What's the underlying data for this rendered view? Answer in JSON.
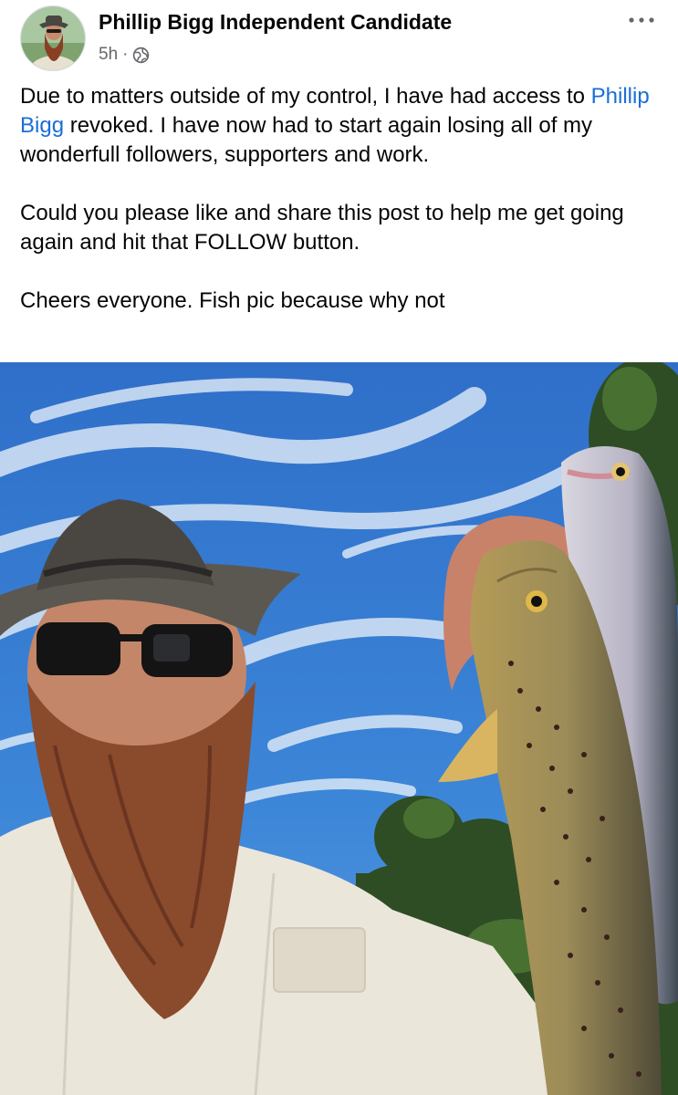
{
  "post": {
    "author": "Phillip Bigg Independent Candidate",
    "timestamp": "5h",
    "separator": "·",
    "privacy_icon": "globe-icon",
    "menu_icon": "more-horizontal-icon",
    "paragraph1": {
      "before": "Due to matters outside of my control, I have had access to ",
      "mention": "Phillip Bigg",
      "after": " revoked. I have now had to start again losing all of my wonderfull followers, supporters and work."
    },
    "paragraph2": "Could you please like and share this post to help me get going again and hit that FOLLOW button.",
    "paragraph3": "Cheers everyone. Fish pic because why not",
    "photo": {
      "subject": "bearded man in hat and sunglasses holding two trout against blue sky"
    }
  },
  "colors": {
    "link": "#1a6ed8",
    "text": "#050505",
    "meta": "#65676b"
  }
}
